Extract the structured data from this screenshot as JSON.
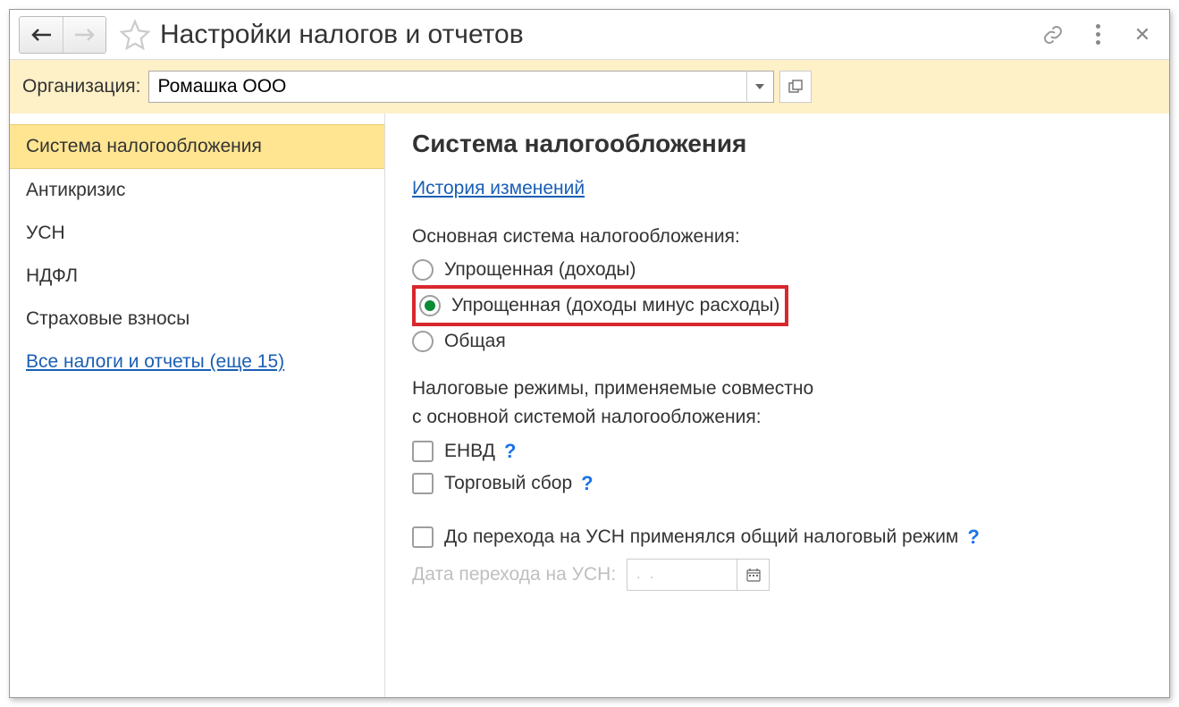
{
  "title": "Настройки налогов и отчетов",
  "org": {
    "label": "Организация:",
    "value": "Ромашка ООО"
  },
  "sidebar": {
    "items": [
      {
        "label": "Система налогообложения",
        "active": true
      },
      {
        "label": "Антикризис"
      },
      {
        "label": "УСН"
      },
      {
        "label": "НДФЛ"
      },
      {
        "label": "Страховые взносы"
      }
    ],
    "all_link": "Все налоги и отчеты (еще 15)"
  },
  "main": {
    "heading": "Система налогообложения",
    "history_link": "История изменений",
    "system_label": "Основная система налогообложения:",
    "radio1": "Упрощенная (доходы)",
    "radio2": "Упрощенная (доходы минус расходы)",
    "radio3": "Общая",
    "regimes_line1": "Налоговые режимы, применяемые совместно",
    "regimes_line2": "с основной системой налогообложения:",
    "check_envd": "ЕНВД",
    "check_ts": "Торговый сбор",
    "check_prior": "До перехода на УСН применялся общий налоговый режим",
    "date_label": "Дата перехода на УСН:",
    "date_value": ". .",
    "help": "?"
  }
}
